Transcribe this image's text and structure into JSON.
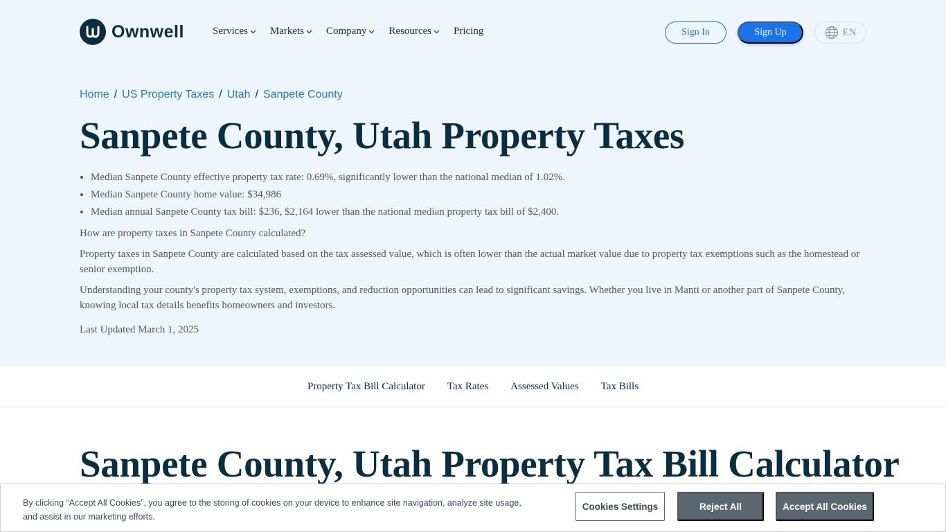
{
  "header": {
    "logo_text": "Ownwell",
    "nav": [
      {
        "label": "Services",
        "has_dropdown": true
      },
      {
        "label": "Markets",
        "has_dropdown": true
      },
      {
        "label": "Company",
        "has_dropdown": true
      },
      {
        "label": "Resources",
        "has_dropdown": true
      },
      {
        "label": "Pricing",
        "has_dropdown": false
      }
    ],
    "sign_in": "Sign In",
    "sign_up": "Sign Up",
    "language": "EN"
  },
  "breadcrumb": [
    "Home",
    "US Property Taxes",
    "Utah",
    "Sanpete County"
  ],
  "page_title": "Sanpete County, Utah Property Taxes",
  "bullets": [
    "Median Sanpete County effective property tax rate: 0.69%, significantly lower than the national median of 1.02%.",
    "Median Sanpete County home value: $34,986",
    "Median annual Sanpete County tax bill: $236, $2,164 lower than the national median property tax bill of $2,400."
  ],
  "paragraphs": [
    "How are property taxes in Sanpete County calculated?",
    "Property taxes in Sanpete County are calculated based on the tax assessed value, which is often lower than the actual market value due to property tax exemptions such as the homestead or senior exemption.",
    "Understanding your county's property tax system, exemptions, and reduction opportunities can lead to significant savings. Whether you live in Manti or another part of Sanpete County, knowing local tax details benefits homeowners and investors."
  ],
  "last_updated": "Last Updated March 1, 2025",
  "tabs": [
    "Property Tax Bill Calculator",
    "Tax Rates",
    "Assessed Values",
    "Tax Bills"
  ],
  "section_title": "Sanpete County, Utah Property Tax Bill Calculator",
  "cookie": {
    "text": "By clicking “Accept All Cookies”, you agree to the storing of cookies on your device to enhance site navigation, analyze site usage, and assist in our marketing efforts.",
    "settings": "Cookies Settings",
    "reject": "Reject All",
    "accept": "Accept All Cookies"
  },
  "colors": {
    "hero_bg": "#eef5fc",
    "brand_navy": "#0b2d40",
    "accent_blue": "#1a73e8",
    "link_blue": "#2a7ab8",
    "cookie_button": "#5a6670"
  }
}
